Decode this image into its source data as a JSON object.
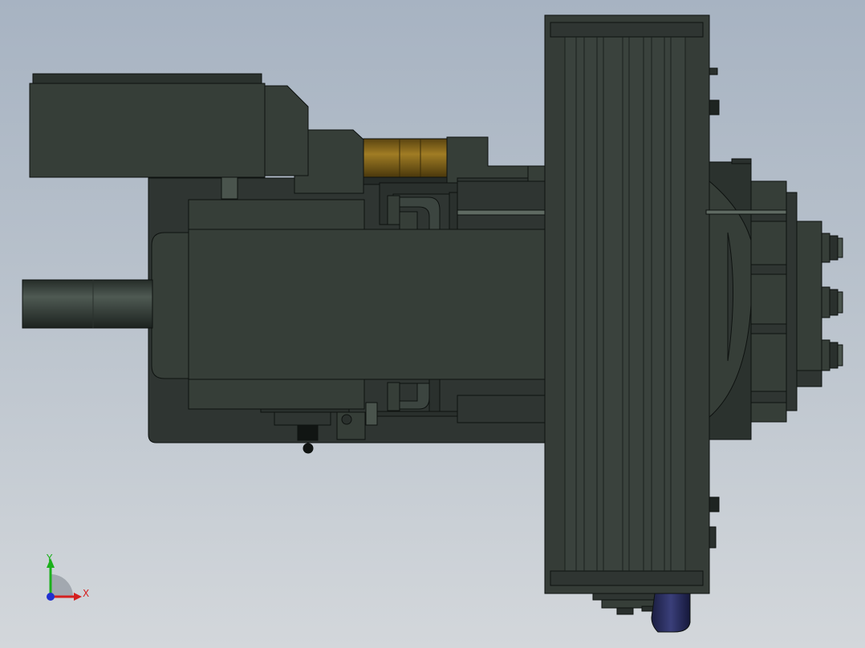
{
  "viewport": {
    "background_top": "#a7b3c2",
    "background_bottom": "#d3d7db"
  },
  "model": {
    "body_color": "#363e38",
    "dark_color": "#1e2421",
    "edge_color": "#0e1210",
    "coupling_color": "#8a6a1c",
    "highlight_color": "#5f6a62"
  },
  "triad": {
    "x_label": "X",
    "y_label": "Y",
    "x_color": "#d42020",
    "y_color": "#1bb01b",
    "z_color": "#2030d0"
  }
}
